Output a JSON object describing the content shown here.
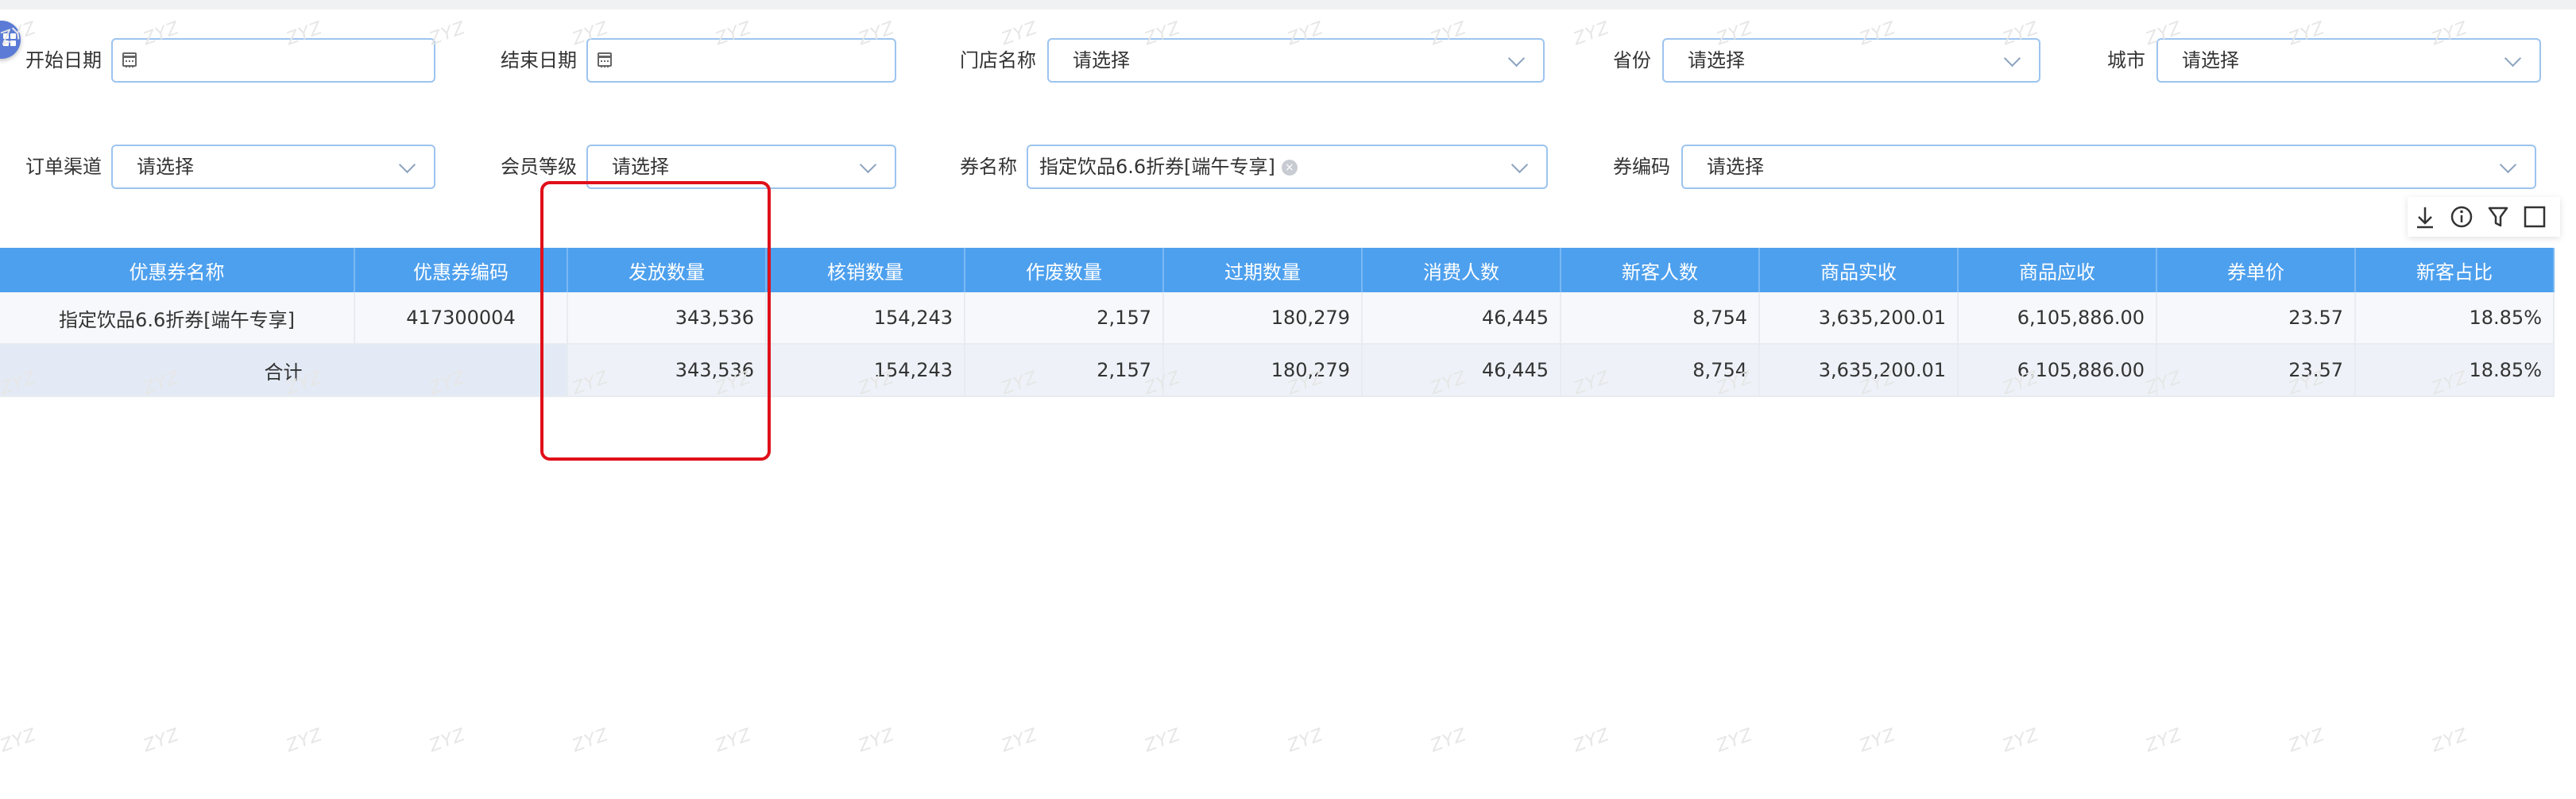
{
  "filters": {
    "start_date": {
      "label": "开始日期",
      "value": ""
    },
    "end_date": {
      "label": "结束日期",
      "value": ""
    },
    "store": {
      "label": "门店名称",
      "value": "请选择"
    },
    "province": {
      "label": "省份",
      "value": "请选择"
    },
    "city": {
      "label": "城市",
      "value": "请选择"
    },
    "channel": {
      "label": "订单渠道",
      "value": "请选择"
    },
    "member_level": {
      "label": "会员等级",
      "value": "请选择"
    },
    "coupon_name": {
      "label": "券名称",
      "value": "指定饮品6.6折券[端午专享]"
    },
    "coupon_code": {
      "label": "券编码",
      "value": "请选择"
    }
  },
  "toolbar": {
    "icons": [
      "download-icon",
      "info-icon",
      "filter-icon",
      "fullscreen-icon"
    ]
  },
  "table": {
    "columns": [
      "优惠券名称",
      "优惠券编码",
      "发放数量",
      "核销数量",
      "作废数量",
      "过期数量",
      "消费人数",
      "新客人数",
      "商品实收",
      "商品应收",
      "券单价",
      "新客占比"
    ],
    "rows": [
      [
        "指定饮品6.6折券[端午专享]",
        "417300004",
        "343,536",
        "154,243",
        "2,157",
        "180,279",
        "46,445",
        "8,754",
        "3,635,200.01",
        "6,105,886.00",
        "23.57",
        "18.85%"
      ]
    ],
    "total": {
      "label": "合计",
      "values": [
        "343,536",
        "154,243",
        "2,157",
        "180,279",
        "46,445",
        "8,754",
        "3,635,200.01",
        "6,105,886.00",
        "23.57",
        "18.85%"
      ]
    }
  },
  "watermark": "ZYZ",
  "colors": {
    "header_bg": "#4da0ee",
    "input_border": "#9dc4ef",
    "highlight": "#e0101a"
  }
}
